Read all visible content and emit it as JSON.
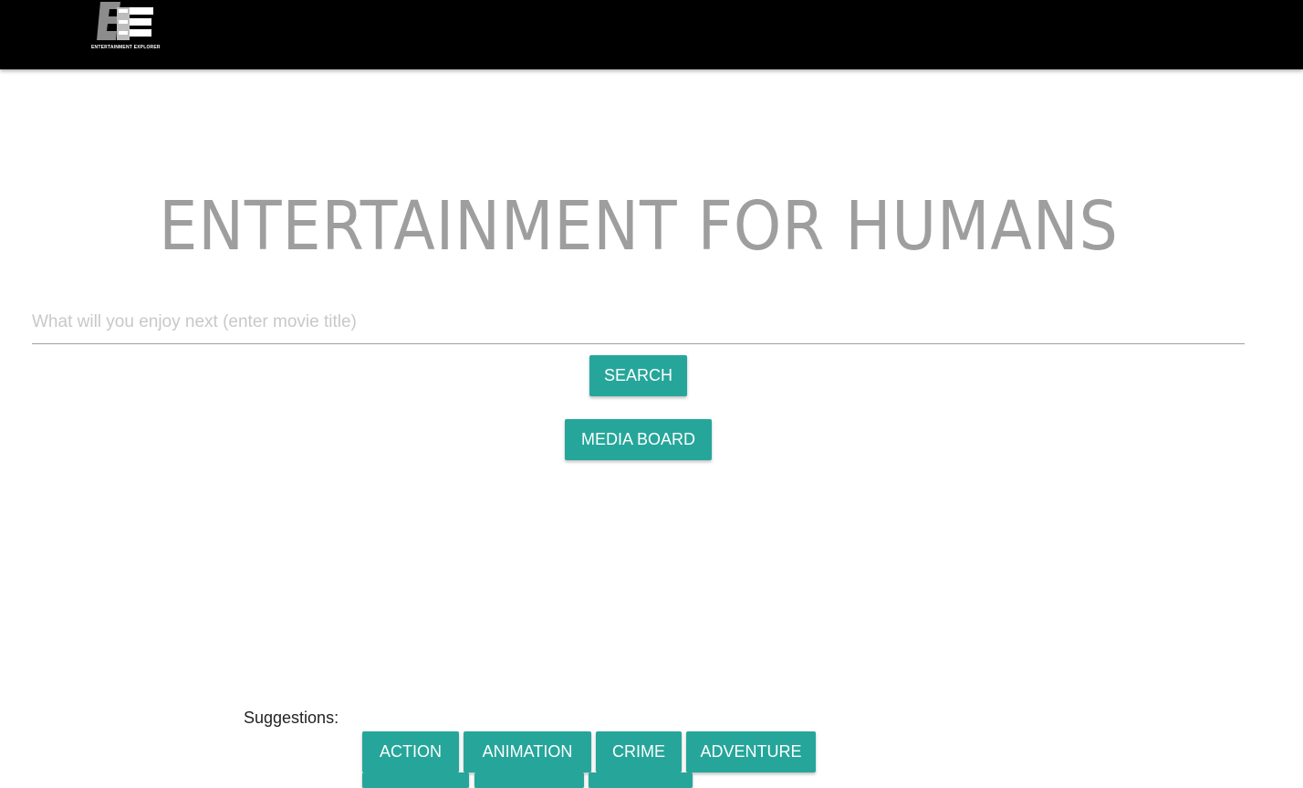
{
  "header": {
    "logo_text": "ENTERTAINMENT EXPLORER",
    "background_color": "#000000"
  },
  "hero": {
    "title": "ENTERTAINMENT FOR HUMANS"
  },
  "search": {
    "placeholder": "What will you enjoy next (enter movie title)",
    "value": "",
    "button_label": "SEARCH"
  },
  "media_board": {
    "button_label": "MEDIA BOARD"
  },
  "suggestions": {
    "label": "Suggestions:",
    "items": [
      {
        "label": "ACTION"
      },
      {
        "label": "ANIMATION"
      },
      {
        "label": "CRIME"
      },
      {
        "label": "ADVENTURE"
      },
      {
        "label": ""
      },
      {
        "label": ""
      },
      {
        "label": ""
      }
    ]
  },
  "colors": {
    "accent": "#26a69a",
    "title_gray": "#9e9e9e"
  }
}
